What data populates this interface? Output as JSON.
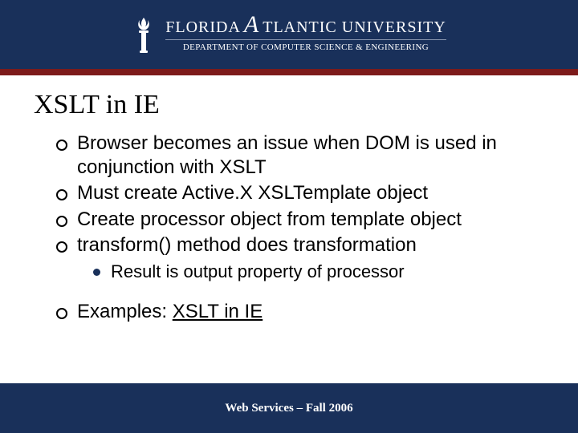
{
  "header": {
    "university_first": "FLORIDA",
    "university_mid": "A",
    "university_last": "TLANTIC UNIVERSITY",
    "department": "DEPARTMENT OF COMPUTER SCIENCE & ENGINEERING"
  },
  "slide": {
    "title": "XSLT in IE",
    "bullets": [
      "Browser becomes an issue when DOM is used in conjunction with XSLT",
      "Must create Active.X XSLTemplate object",
      "Create processor object from template object",
      " transform() method does transformation"
    ],
    "sub_bullet": "Result is output property of processor",
    "examples_prefix": "Examples: ",
    "examples_link": "XSLT in IE"
  },
  "footer": {
    "text": "Web Services – Fall 2006"
  }
}
